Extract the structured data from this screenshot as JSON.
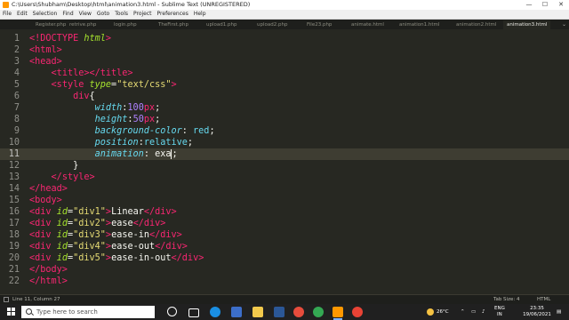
{
  "window": {
    "title": "C:\\Users\\Shubham\\Desktop\\html\\animation3.html - Sublime Text (UNREGISTERED)",
    "minimize": "—",
    "maximize": "☐",
    "close": "✕"
  },
  "menu": [
    "File",
    "Edit",
    "Selection",
    "Find",
    "View",
    "Goto",
    "Tools",
    "Project",
    "Preferences",
    "Help"
  ],
  "tabs": [
    "Register.php",
    "retrive.php",
    "login.php",
    "TheFirst.php",
    "upload1.php",
    "upload2.php",
    "File23.php",
    "animate.html",
    "animation1.html",
    "animation2.html",
    "animation3.html"
  ],
  "active_tab": "animation3.html",
  "editor": {
    "current_line": 11,
    "line_numbers": [
      "1",
      "2",
      "3",
      "4",
      "5",
      "6",
      "7",
      "8",
      "9",
      "10",
      "11",
      "12",
      "13",
      "14",
      "15",
      "16",
      "17",
      "18",
      "19",
      "20",
      "21",
      "22"
    ],
    "lines": [
      {
        "tok": [
          [
            "t",
            "<!"
          ],
          [
            "t",
            "DOCTYPE"
          ],
          [
            "f",
            " "
          ],
          [
            "a",
            "html"
          ],
          [
            "t",
            ">"
          ]
        ]
      },
      {
        "tok": [
          [
            "t",
            "<html>"
          ]
        ]
      },
      {
        "tok": [
          [
            "t",
            "<head>"
          ]
        ]
      },
      {
        "tok": [
          [
            "f",
            "    "
          ],
          [
            "t",
            "<title></title>"
          ]
        ]
      },
      {
        "tok": [
          [
            "f",
            "    "
          ],
          [
            "t",
            "<style"
          ],
          [
            "f",
            " "
          ],
          [
            "a",
            "type"
          ],
          [
            "f",
            "="
          ],
          [
            "s",
            "\"text/css\""
          ],
          [
            "t",
            ">"
          ]
        ]
      },
      {
        "tok": [
          [
            "f",
            "        "
          ],
          [
            "t",
            "div"
          ],
          [
            "f",
            "{"
          ]
        ]
      },
      {
        "tok": [
          [
            "f",
            "            "
          ],
          [
            "p",
            "width"
          ],
          [
            "f",
            ":"
          ],
          [
            "n",
            "100"
          ],
          [
            "u",
            "px"
          ],
          [
            "f",
            ";"
          ]
        ]
      },
      {
        "tok": [
          [
            "f",
            "            "
          ],
          [
            "p",
            "height"
          ],
          [
            "f",
            ":"
          ],
          [
            "n",
            "50"
          ],
          [
            "u",
            "px"
          ],
          [
            "f",
            ";"
          ]
        ]
      },
      {
        "tok": [
          [
            "f",
            "            "
          ],
          [
            "p",
            "background-color"
          ],
          [
            "f",
            ": "
          ],
          [
            "v",
            "red"
          ],
          [
            "f",
            ";"
          ]
        ]
      },
      {
        "tok": [
          [
            "f",
            "            "
          ],
          [
            "p",
            "position"
          ],
          [
            "f",
            ":"
          ],
          [
            "v",
            "relative"
          ],
          [
            "f",
            ";"
          ]
        ]
      },
      {
        "tok": [
          [
            "f",
            "            "
          ],
          [
            "p",
            "animation"
          ],
          [
            "f",
            ": exa"
          ],
          [
            "c",
            ""
          ],
          [
            "f",
            ";"
          ]
        ]
      },
      {
        "tok": [
          [
            "f",
            "        }"
          ]
        ]
      },
      {
        "tok": [
          [
            "f",
            "    "
          ],
          [
            "t",
            "</style>"
          ]
        ]
      },
      {
        "tok": [
          [
            "t",
            "</head>"
          ]
        ]
      },
      {
        "tok": [
          [
            "t",
            "<body>"
          ]
        ]
      },
      {
        "tok": [
          [
            "t",
            "<div"
          ],
          [
            "f",
            " "
          ],
          [
            "a",
            "id"
          ],
          [
            "f",
            "="
          ],
          [
            "s",
            "\"div1\""
          ],
          [
            "t",
            ">"
          ],
          [
            "f",
            "Linear"
          ],
          [
            "t",
            "</div>"
          ]
        ]
      },
      {
        "tok": [
          [
            "t",
            "<div"
          ],
          [
            "f",
            " "
          ],
          [
            "a",
            "id"
          ],
          [
            "f",
            "="
          ],
          [
            "s",
            "\"div2\""
          ],
          [
            "t",
            ">"
          ],
          [
            "f",
            "ease"
          ],
          [
            "t",
            "</div>"
          ]
        ]
      },
      {
        "tok": [
          [
            "t",
            "<div"
          ],
          [
            "f",
            " "
          ],
          [
            "a",
            "id"
          ],
          [
            "f",
            "="
          ],
          [
            "s",
            "\"div3\""
          ],
          [
            "t",
            ">"
          ],
          [
            "f",
            "ease-in"
          ],
          [
            "t",
            "</div>"
          ]
        ]
      },
      {
        "tok": [
          [
            "t",
            "<div"
          ],
          [
            "f",
            " "
          ],
          [
            "a",
            "id"
          ],
          [
            "f",
            "="
          ],
          [
            "s",
            "\"div4\""
          ],
          [
            "t",
            ">"
          ],
          [
            "f",
            "ease-out"
          ],
          [
            "t",
            "</div>"
          ]
        ]
      },
      {
        "tok": [
          [
            "t",
            "<div"
          ],
          [
            "f",
            " "
          ],
          [
            "a",
            "id"
          ],
          [
            "f",
            "="
          ],
          [
            "s",
            "\"div5\""
          ],
          [
            "t",
            ">"
          ],
          [
            "f",
            "ease-in-out"
          ],
          [
            "t",
            "</div>"
          ]
        ]
      },
      {
        "tok": [
          [
            "t",
            "</body>"
          ]
        ]
      },
      {
        "tok": [
          [
            "t",
            "</html>"
          ]
        ]
      }
    ]
  },
  "status": {
    "position": "Line 11, Column 27",
    "tab_size": "Tab Size: 4",
    "syntax": "HTML"
  },
  "taskbar": {
    "search_placeholder": "Type here to search",
    "temperature": "26°C",
    "language": "ENG",
    "region": "IN",
    "time": "23:35",
    "date": "19/06/2021"
  },
  "colors": {
    "editor_bg": "#272822",
    "tag": "#f92672",
    "attribute": "#a6e22e",
    "string": "#e6db74",
    "property": "#66d9ef",
    "number": "#ae81ff",
    "taskbar_bg": "#202020"
  }
}
